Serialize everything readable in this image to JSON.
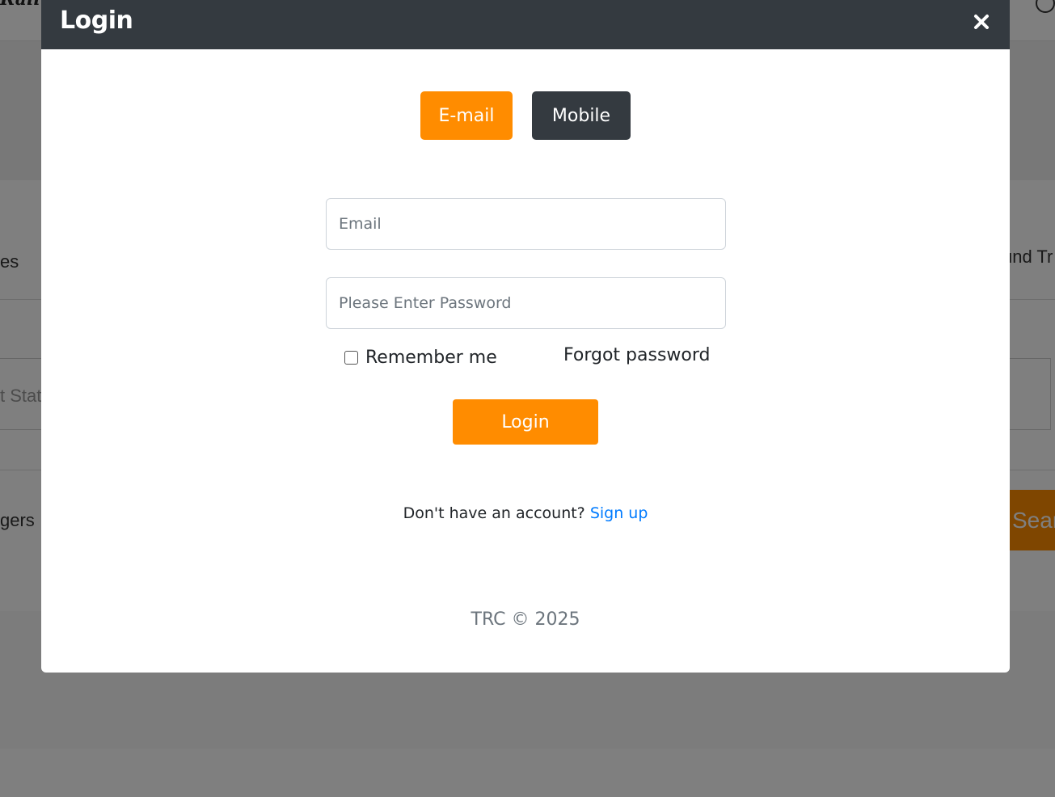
{
  "background": {
    "brand": "Railw",
    "left_labels": {
      "trip_types": "es",
      "station": "t Stat",
      "passengers": "gers"
    },
    "right_label": "und Tr",
    "search_label": "Sear"
  },
  "modal": {
    "title": "Login",
    "close_icon": "close-icon",
    "tabs": [
      {
        "label": "E-mail",
        "active": true
      },
      {
        "label": "Mobile",
        "active": false
      }
    ],
    "email_placeholder": "Email",
    "password_placeholder": "Please Enter Password",
    "remember_label": "Remember me",
    "remember_checked": false,
    "forgot_label": "Forgot password",
    "login_label": "Login",
    "signup_prompt": "Don't have an account?",
    "signup_link": "Sign up",
    "footer": "TRC © 2025"
  },
  "colors": {
    "accent": "#ff8c00",
    "header": "#343a40",
    "link": "#007bff"
  }
}
